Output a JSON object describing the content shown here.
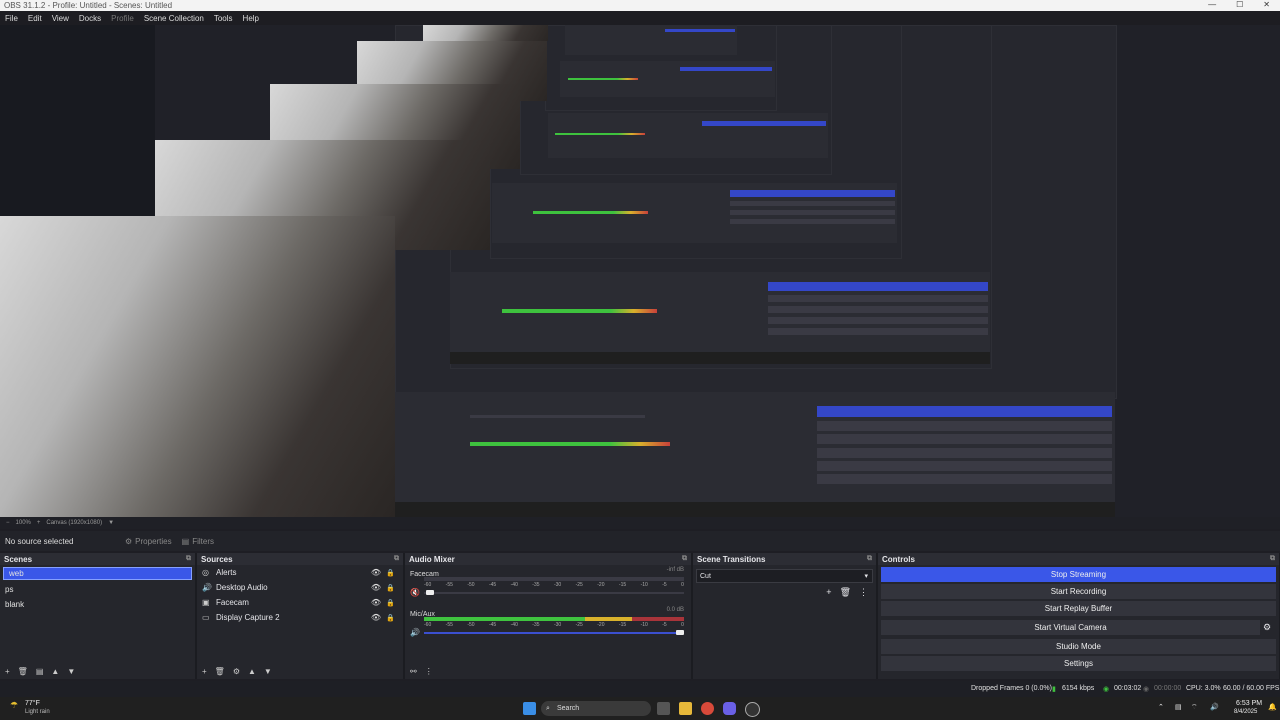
{
  "window": {
    "title": "OBS 31.1.2 - Profile: Untitled - Scenes: Untitled"
  },
  "menu": [
    "File",
    "Edit",
    "View",
    "Docks",
    "Profile",
    "Scene Collection",
    "Tools",
    "Help"
  ],
  "preview_status": {
    "zoom": "100%",
    "canvas": "Canvas (1920x1080)"
  },
  "toolbar": {
    "no_source": "No source selected",
    "properties": "Properties",
    "filters": "Filters"
  },
  "scenes": {
    "title": "Scenes",
    "items": [
      "web",
      "ps",
      "blank"
    ]
  },
  "sources": {
    "title": "Sources",
    "items": [
      {
        "icon": "alerts-icon",
        "label": "Alerts"
      },
      {
        "icon": "speaker-icon",
        "label": "Desktop Audio"
      },
      {
        "icon": "camera-icon",
        "label": "Facecam"
      },
      {
        "icon": "monitor-icon",
        "label": "Display Capture 2"
      }
    ]
  },
  "mixer": {
    "title": "Audio Mixer",
    "channels": [
      {
        "name": "Facecam",
        "db": "-inf dB",
        "level": 0.0
      },
      {
        "name": "Mic/Aux",
        "db": "0.0 dB",
        "level": 0.95
      }
    ],
    "scale": [
      "-60",
      "-55",
      "-50",
      "-45",
      "-40",
      "-35",
      "-30",
      "-25",
      "-20",
      "-15",
      "-10",
      "-5",
      "0"
    ]
  },
  "transitions": {
    "title": "Scene Transitions",
    "selected": "Cut"
  },
  "controls": {
    "title": "Controls",
    "buttons": [
      "Stop Streaming",
      "Start Recording",
      "Start Replay Buffer",
      "Start Virtual Camera",
      "Studio Mode",
      "Settings"
    ]
  },
  "stats": {
    "dropped": "Dropped Frames 0 (0.0%)",
    "kbps": "6154 kbps",
    "stream_time": "00:03:02",
    "rec_time": "00:00:00",
    "cpu": "CPU: 3.0%",
    "fps": "60.00 / 60.00 FPS"
  },
  "taskbar": {
    "weather_temp": "77°F",
    "weather_desc": "Light rain",
    "search": "Search",
    "time": "6:53 PM",
    "date": "8/4/2025"
  },
  "colors": {
    "accent": "#3a57e8"
  }
}
